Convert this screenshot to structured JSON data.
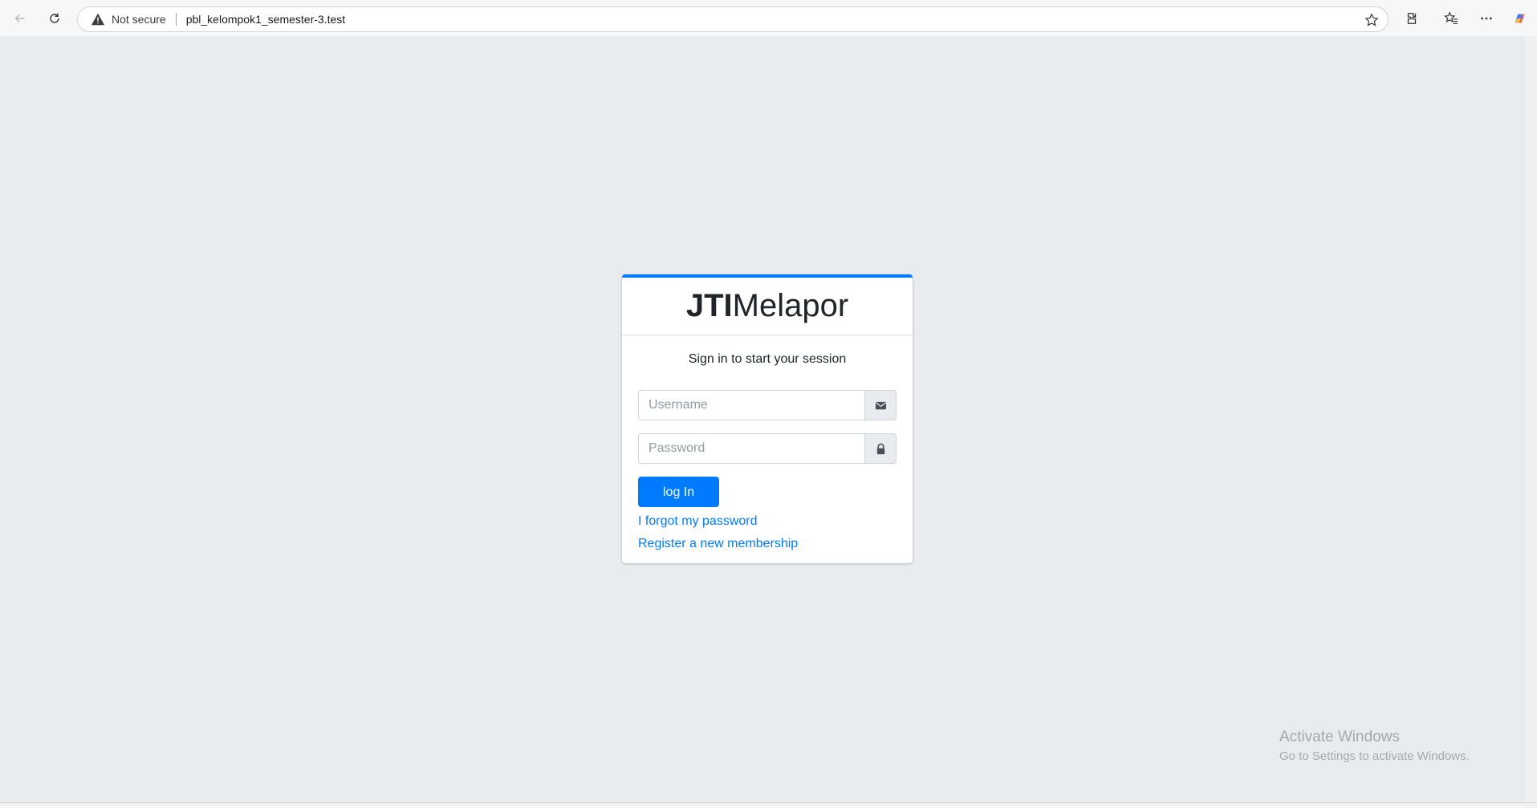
{
  "browser": {
    "address": {
      "security_label": "Not secure",
      "url": "pbl_kelompok1_semester-3.test"
    },
    "icons": [
      "back-arrow-icon",
      "refresh-icon",
      "warning-icon",
      "star-icon",
      "extensions-icon",
      "favorites-icon",
      "more-icon",
      "copilot-icon"
    ]
  },
  "login": {
    "logo_bold": "JTI",
    "logo_light": "Melapor",
    "message": "Sign in to start your session",
    "username_placeholder": "Username",
    "password_placeholder": "Password",
    "login_label": "log In",
    "forgot_label": "I forgot my password",
    "register_label": "Register a new membership"
  },
  "watermark": {
    "title": "Activate Windows",
    "subtitle": "Go to Settings to activate Windows."
  },
  "colors": {
    "primary": "#007bff",
    "background": "#e9ecef"
  }
}
